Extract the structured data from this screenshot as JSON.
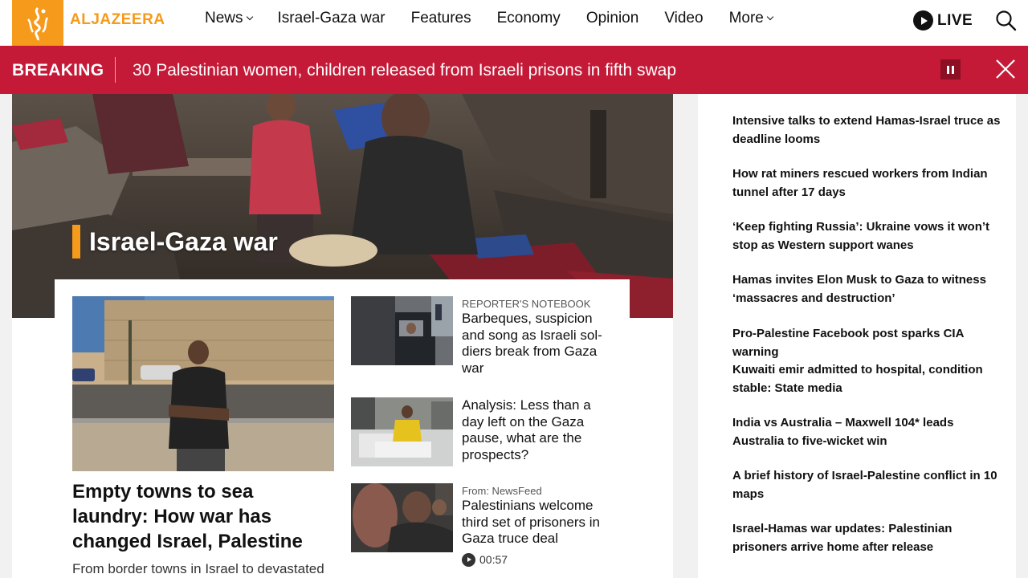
{
  "header": {
    "logo_text": "ALJAZEERA",
    "nav": [
      {
        "label": "News",
        "has_dropdown": true
      },
      {
        "label": "Israel-Gaza war",
        "has_dropdown": false
      },
      {
        "label": "Features",
        "has_dropdown": false
      },
      {
        "label": "Economy",
        "has_dropdown": false
      },
      {
        "label": "Opinion",
        "has_dropdown": false
      },
      {
        "label": "Video",
        "has_dropdown": false
      },
      {
        "label": "More",
        "has_dropdown": true
      }
    ],
    "live_label": "LIVE",
    "icons": {
      "logo": "aljazeera-logo-icon",
      "live": "play-icon",
      "search": "search-icon"
    }
  },
  "breaking": {
    "label": "BREAKING",
    "text": "30 Palestinian women, children released from Israeli prisons in fifth swap",
    "icons": {
      "pause": "pause-icon",
      "close": "close-icon"
    }
  },
  "hero": {
    "title": "Israel-Gaza war"
  },
  "lead_story": {
    "title": "Empty towns to sea laundry: How war has changed Israel, Palestine",
    "summary": "From border towns in Israel to devastated"
  },
  "stories": [
    {
      "kicker": "REPORTER'S NOTEBOOK",
      "title": "Barbeques, suspicion and song as Israeli sol-diers break from Gaza war"
    },
    {
      "kicker": "",
      "title": "Analysis: Less than a day left on the Gaza pause, what are the prospects?"
    },
    {
      "kicker": "From: NewsFeed",
      "title": "Palestinians welcome third set of prisoners in Gaza truce deal",
      "duration": "00:57"
    }
  ],
  "sidebar": {
    "items": [
      "Intensive talks to extend Hamas-Israel truce as deadline looms",
      "How rat miners rescued workers from Indian tunnel after 17 days",
      "‘Keep fighting Russia’: Ukraine vows it won’t stop as Western support wanes",
      "Hamas invites Elon Musk to Gaza to witness ‘massacres and destruction’",
      "Pro-Palestine Facebook post sparks CIA warning",
      "Kuwaiti emir admitted to hospital, condition stable: State media",
      "India vs Australia – Maxwell 104* leads Australia to five-wicket win",
      "A brief history of Israel-Palestine conflict in 10 maps",
      "Israel-Hamas war updates: Palestinian prisoners arrive home after release"
    ]
  },
  "colors": {
    "brand": "#f59a1b",
    "breaking": "#c41a37",
    "text": "#111111",
    "background": "#f1f1f1"
  }
}
